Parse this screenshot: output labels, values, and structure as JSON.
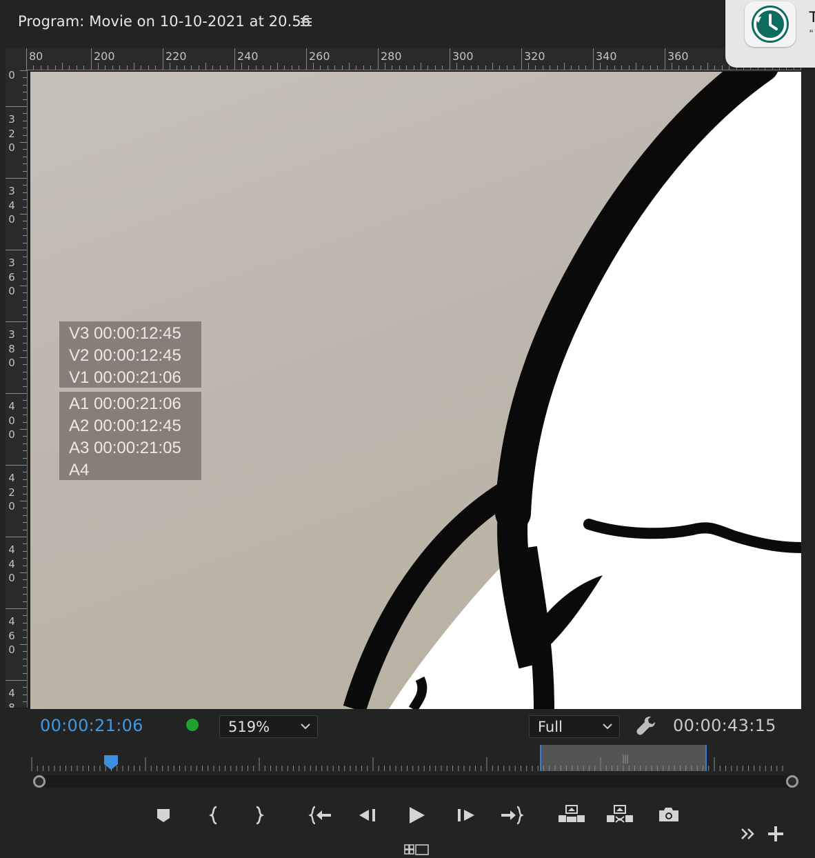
{
  "panel": {
    "title": "Program: Movie on 10-10-2021 at 20.56",
    "menu_icon": "hamburger-menu-icon"
  },
  "notification": {
    "icon": "time-machine-icon",
    "text_line1": "T",
    "text_line2": "“"
  },
  "ruler": {
    "horizontal_labels": [
      "80",
      "200",
      "220",
      "240",
      "260",
      "280",
      "300",
      "320",
      "340",
      "360"
    ],
    "vertical_labels": [
      "0",
      "320",
      "340",
      "360",
      "380",
      "400",
      "420",
      "440",
      "460",
      "48"
    ]
  },
  "timecode_overlay": {
    "video_tracks": [
      {
        "track": "V3",
        "timecode": "00:00:12:45",
        "text": "V3 00:00:12:45"
      },
      {
        "track": "V2",
        "timecode": "00:00:12:45",
        "text": "V2 00:00:12:45"
      },
      {
        "track": "V1",
        "timecode": "00:00:21:06",
        "text": "V1 00:00:21:06"
      }
    ],
    "audio_tracks": [
      {
        "track": "A1",
        "timecode": "00:00:21:06",
        "text": "A1 00:00:21:06"
      },
      {
        "track": "A2",
        "timecode": "00:00:12:45",
        "text": "A2 00:00:12:45"
      },
      {
        "track": "A3",
        "timecode": "00:00:21:05",
        "text": "A3 00:00:21:05"
      },
      {
        "track": "A4",
        "timecode": "",
        "text": "A4"
      }
    ]
  },
  "controls": {
    "current_timecode": "00:00:21:06",
    "zoom_level": "519%",
    "resolution": "Full",
    "duration": "00:00:43:15",
    "record_indicator_color": "#22a033",
    "timecode_color": "#3f9ae6"
  },
  "transport_buttons": [
    {
      "name": "add-marker-button",
      "icon": "marker-icon"
    },
    {
      "name": "mark-in-button",
      "icon": "mark-in-icon"
    },
    {
      "name": "mark-out-button",
      "icon": "mark-out-icon"
    },
    {
      "name": "go-to-in-button",
      "icon": "go-to-in-icon"
    },
    {
      "name": "step-back-button",
      "icon": "step-back-icon"
    },
    {
      "name": "play-button",
      "icon": "play-icon"
    },
    {
      "name": "step-forward-button",
      "icon": "step-forward-icon"
    },
    {
      "name": "go-to-out-button",
      "icon": "go-to-out-icon"
    },
    {
      "name": "lift-button",
      "icon": "lift-icon"
    },
    {
      "name": "extract-button",
      "icon": "extract-icon"
    },
    {
      "name": "export-frame-button",
      "icon": "camera-icon"
    }
  ],
  "bottom": {
    "more_icon": "double-chevron-right-icon",
    "add_icon": "plus-icon",
    "layout_icon": "multi-camera-layout-icon"
  }
}
